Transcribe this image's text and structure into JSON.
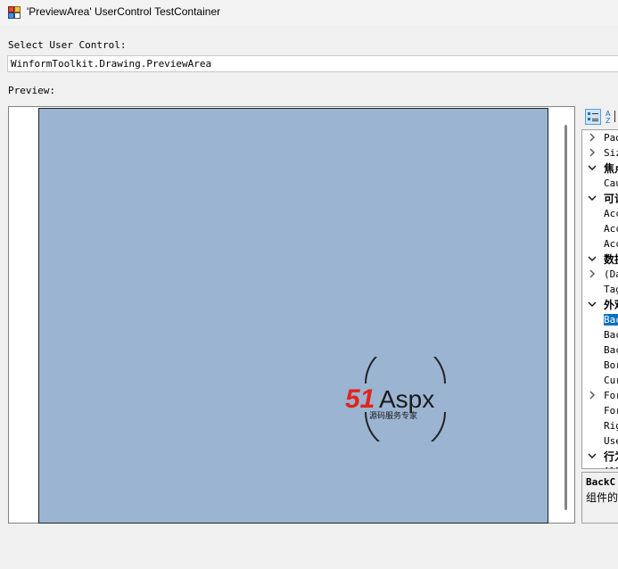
{
  "window": {
    "title": "'PreviewArea' UserControl TestContainer"
  },
  "select": {
    "label": "Select User Control:",
    "value": "WinformToolkit.Drawing.PreviewArea"
  },
  "preview": {
    "label": "Preview:",
    "background": "#9bb4d1"
  },
  "watermark": {
    "brand_num": "51",
    "brand_text": "Aspx",
    "tagline": "源码服务专家"
  },
  "property_grid": {
    "rows": [
      {
        "text": "Pad",
        "kind": "expandable"
      },
      {
        "text": "Siz",
        "kind": "expandable"
      },
      {
        "text": "焦点",
        "kind": "category"
      },
      {
        "text": "Cau",
        "kind": "prop"
      },
      {
        "text": "可访",
        "kind": "category"
      },
      {
        "text": "Acc",
        "kind": "prop"
      },
      {
        "text": "Acc",
        "kind": "prop"
      },
      {
        "text": "Acc",
        "kind": "prop"
      },
      {
        "text": "数据",
        "kind": "category"
      },
      {
        "text": "(Da",
        "kind": "expandable"
      },
      {
        "text": "Tag",
        "kind": "prop"
      },
      {
        "text": "外观",
        "kind": "category"
      },
      {
        "text": "Bac",
        "kind": "selected"
      },
      {
        "text": "Bac",
        "kind": "prop"
      },
      {
        "text": "Bac",
        "kind": "prop"
      },
      {
        "text": "Bor",
        "kind": "prop"
      },
      {
        "text": "Cur",
        "kind": "prop"
      },
      {
        "text": "For",
        "kind": "expandable"
      },
      {
        "text": "For",
        "kind": "prop"
      },
      {
        "text": "Rig",
        "kind": "prop"
      },
      {
        "text": "Use",
        "kind": "prop"
      },
      {
        "text": "行为",
        "kind": "category"
      },
      {
        "text": "All",
        "kind": "prop"
      }
    ],
    "description": {
      "title": "BackC",
      "text": "组件的"
    }
  }
}
